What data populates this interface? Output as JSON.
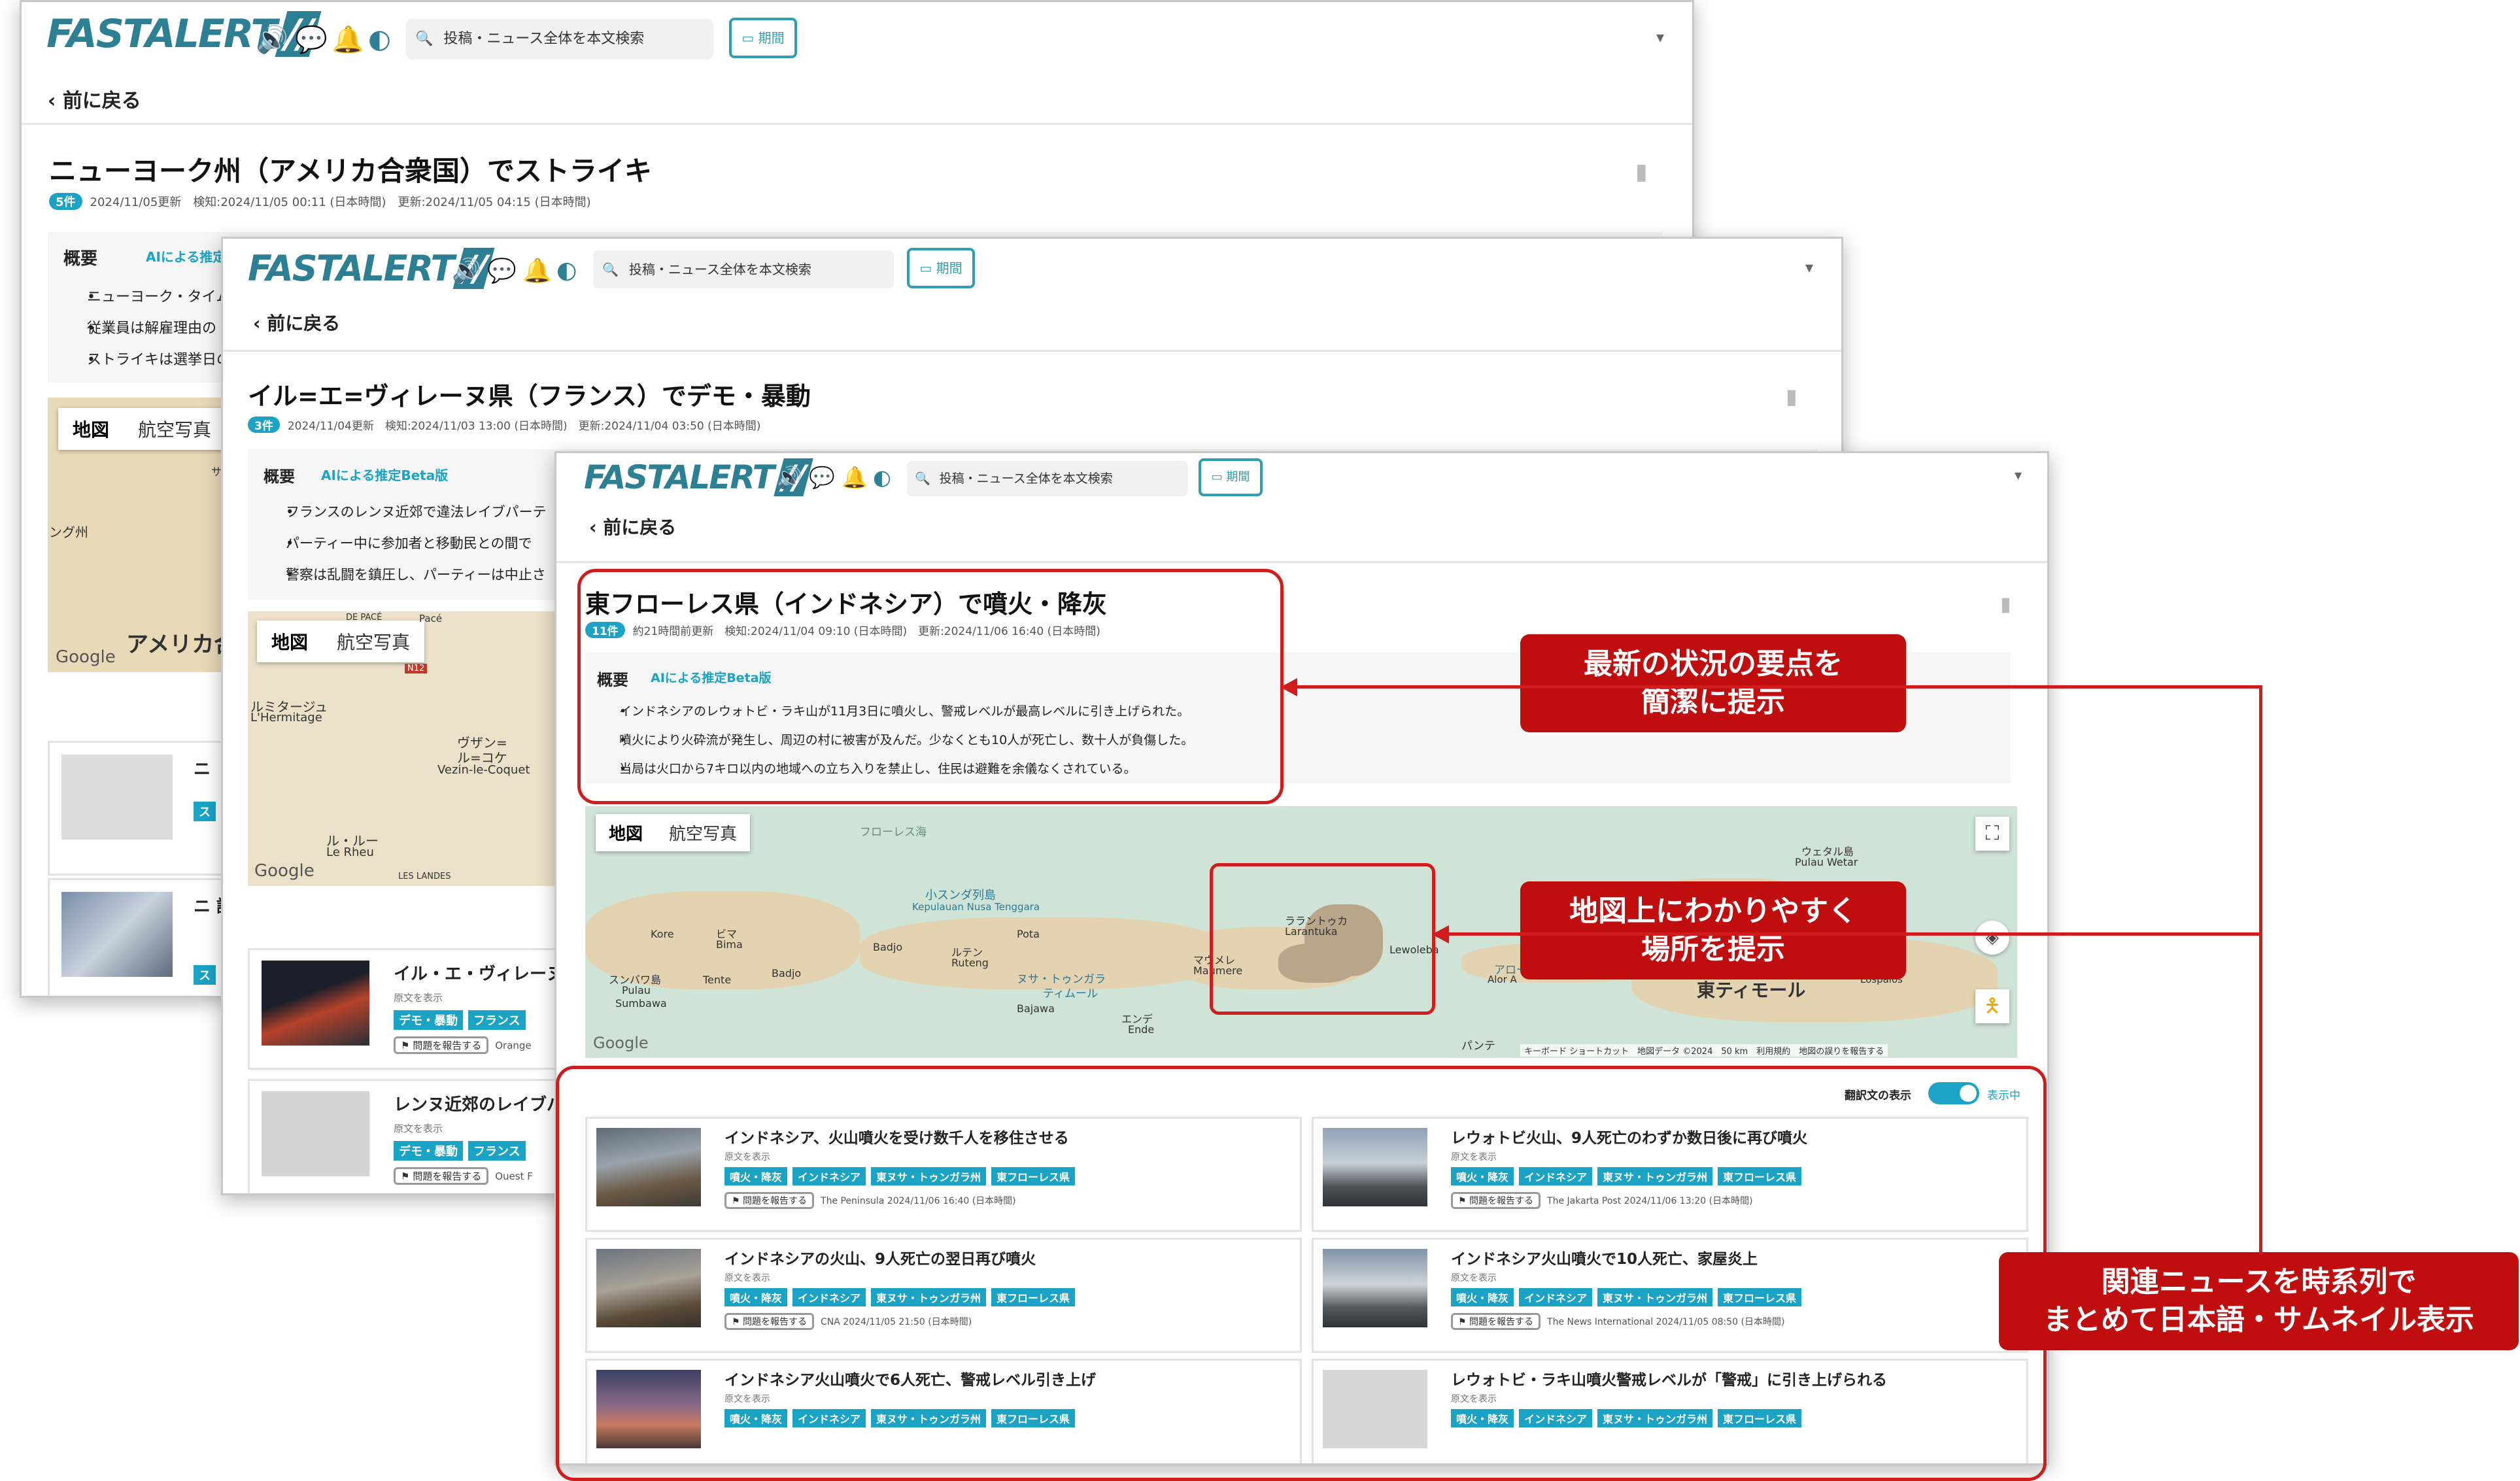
{
  "logo": "FASTALERT",
  "search_placeholder": "投稿・ニュース全体を本文検索",
  "period_label": "期間",
  "back_label": "前に戻る",
  "summary_label": "概要",
  "ai_badge": "AIによる推定Beta版",
  "map_tabs": {
    "map": "地図",
    "aerial": "航空写真"
  },
  "report_label": "問題を報告する",
  "orig_label": "原文を表示",
  "w1": {
    "title": "ニューヨーク州（アメリカ合衆国）でストライキ",
    "count": "5件",
    "meta": "2024/11/05更新　検知:2024/11/05 00:11 (日本時間)　更新:2024/11/05 04:15 (日本時間)",
    "bullets": [
      "ニューヨーク・タイム",
      "従業員は解雇理由の",
      "ストライキは選挙日の"
    ],
    "map_labels": [
      "アメリカ合",
      "ング州",
      "サ"
    ],
    "cards": [
      {
        "title": "ニ",
        "tag": "ス"
      },
      {
        "title": "ニ 護",
        "tag": "ス"
      }
    ]
  },
  "w2": {
    "title": "イル=エ=ヴィレーヌ県（フランス）でデモ・暴動",
    "count": "3件",
    "meta": "2024/11/04更新　検知:2024/11/03 13:00 (日本時間)　更新:2024/11/04 03:50 (日本時間)",
    "bullets": [
      "フランスのレンヌ近郊で違法レイブパーテ",
      "パーティー中に参加者と移動民との間で",
      "警察は乱闘を鎮圧し、パーティーは中止さ"
    ],
    "map_labels": [
      "DE PACÉ",
      "Pacé",
      "N12",
      "ルミタージュ",
      "L'Hermitage",
      "ヴザン=",
      "ル=コケ",
      "Vezin-le-Coquet",
      "ル・ルー",
      "Le Rheu",
      "LES LANDES"
    ],
    "cards": [
      {
        "title": "イル・エ・ヴィレーヌ",
        "tags": [
          "デモ・暴動",
          "フランス"
        ],
        "source": "Orange"
      },
      {
        "title": "レンヌ近郊のレイブパ",
        "tags": [
          "デモ・暴動",
          "フランス"
        ],
        "source": "Ouest F"
      }
    ]
  },
  "w3": {
    "title": "東フローレス県（インドネシア）で噴火・降灰",
    "count": "11件",
    "meta": "約21時間前更新　検知:2024/11/04 09:10 (日本時間)　更新:2024/11/06 16:40 (日本時間)",
    "bullets": [
      "インドネシアのレウォトビ・ラキ山が11月3日に噴火し、警戒レベルが最高レベルに引き上げられた。",
      "噴火により火砕流が発生し、周辺の村に被害が及んだ。少なくとも10人が死亡し、数十人が負傷した。",
      "当局は火口から7キロ以内の地域への立ち入りを禁止し、住民は避難を余儀なくされている。"
    ],
    "map_labels": [
      {
        "t": "フローレス海"
      },
      {
        "t": "小スンダ列島"
      },
      {
        "t": "Kepulauan Nusa Tenggara"
      },
      {
        "t": "Kore"
      },
      {
        "t": "ビマ"
      },
      {
        "t": "Bima"
      },
      {
        "t": "Badjo"
      },
      {
        "t": "Badjo"
      },
      {
        "t": "ルテン"
      },
      {
        "t": "Ruteng"
      },
      {
        "t": "Pota"
      },
      {
        "t": "ヌサ・トゥンガラ"
      },
      {
        "t": "ティムール"
      },
      {
        "t": "スンバワ島"
      },
      {
        "t": "Pulau"
      },
      {
        "t": "Sumbawa"
      },
      {
        "t": "Tente"
      },
      {
        "t": "Bajawa"
      },
      {
        "t": "エンデ"
      },
      {
        "t": "Ende"
      },
      {
        "t": "マウメレ"
      },
      {
        "t": "Maumere"
      },
      {
        "t": "ララントゥカ"
      },
      {
        "t": "Larantuka"
      },
      {
        "t": "Lewoleba"
      },
      {
        "t": "ウェタル島"
      },
      {
        "t": "Pulau Wetar"
      },
      {
        "t": "アロー"
      },
      {
        "t": "Alor A"
      },
      {
        "t": "東ティモール"
      },
      {
        "t": "Lospalos"
      },
      {
        "t": "パンテ"
      },
      {
        "t": "Google"
      }
    ],
    "map_footer": "キーボード ショートカット　地図データ ©2024　50 km　利用規約　地図の誤りを報告する",
    "translation_toggle": "翻訳文の表示",
    "translation_state": "表示中",
    "tags": [
      "噴火・降灰",
      "インドネシア",
      "東ヌサ・トゥンガラ州",
      "東フローレス県"
    ],
    "cards": [
      {
        "title": "インドネシア、火山噴火を受け数千人を移住させる",
        "source": "The Peninsula 2024/11/06 16:40 (日本時間)"
      },
      {
        "title": "レウォトビ火山、9人死亡のわずか数日後に再び噴火",
        "source": "The Jakarta Post 2024/11/06 13:20 (日本時間)"
      },
      {
        "title": "インドネシアの火山、9人死亡の翌日再び噴火",
        "source": "CNA 2024/11/05 21:50 (日本時間)"
      },
      {
        "title": "インドネシア火山噴火で10人死亡、家屋炎上",
        "source": "The News International 2024/11/05 08:50 (日本時間)"
      },
      {
        "title": "インドネシア火山噴火で6人死亡、警戒レベル引き上げ",
        "source": ""
      },
      {
        "title": "レウォトビ・ラキ山噴火警戒レベルが「警戒」に引き上げられる",
        "source": ""
      }
    ]
  },
  "callouts": {
    "c1": "最新の状況の要点を\n簡潔に提示",
    "c2": "地図上にわかりやすく\n場所を提示",
    "c3": "関連ニュースを時系列で\nまとめて日本語・サムネイル表示"
  },
  "colors": {
    "accent": "#1aa3c4",
    "logo": "#2d7f93",
    "callout_red": "#c00d0d"
  },
  "icons": [
    "speaker-icon",
    "chat-icon",
    "bell-icon",
    "contrast-icon",
    "search-icon",
    "calendar-icon",
    "bookmark-icon",
    "flag-icon",
    "fullscreen-icon",
    "pegman-icon"
  ]
}
